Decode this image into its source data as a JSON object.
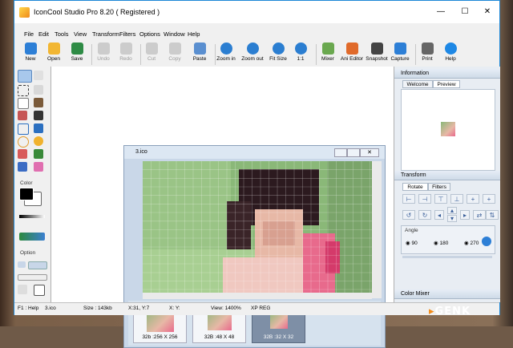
{
  "window": {
    "title": "IconCool Studio Pro 8.20 ( Registered )",
    "controls": [
      "—",
      "☐",
      "✕"
    ]
  },
  "menu": [
    "File",
    "Edit",
    "Tools",
    "View",
    "Transform",
    "Filters",
    "Options",
    "Window",
    "Help"
  ],
  "toolbar": [
    {
      "label": "New",
      "icon": "new-icon",
      "color": "#2d7fd6",
      "disabled": false
    },
    {
      "label": "Open",
      "icon": "open-icon",
      "color": "#f2b632",
      "disabled": false
    },
    {
      "label": "Save",
      "icon": "save-icon",
      "color": "#2e8b45",
      "disabled": false
    },
    {
      "label": "Undo",
      "icon": "undo-icon",
      "color": "#8a8a8a",
      "disabled": true
    },
    {
      "label": "Redo",
      "icon": "redo-icon",
      "color": "#8a8a8a",
      "disabled": true
    },
    {
      "label": "Cut",
      "icon": "cut-icon",
      "color": "#8a8a8a",
      "disabled": true
    },
    {
      "label": "Copy",
      "icon": "copy-icon",
      "color": "#8a8a8a",
      "disabled": true
    },
    {
      "label": "Paste",
      "icon": "paste-icon",
      "color": "#5a8fd0",
      "disabled": false
    },
    {
      "label": "Zoom in",
      "icon": "zoom-in-icon",
      "color": "#2b7ed1",
      "disabled": false
    },
    {
      "label": "Zoom out",
      "icon": "zoom-out-icon",
      "color": "#2b7ed1",
      "disabled": false
    },
    {
      "label": "Fit Size",
      "icon": "fit-size-icon",
      "color": "#2b7ed1",
      "disabled": false
    },
    {
      "label": "1:1",
      "icon": "actual-size-icon",
      "color": "#2b7ed1",
      "disabled": false
    },
    {
      "label": "Mixer",
      "icon": "mixer-icon",
      "color": "#6aa84f",
      "disabled": false
    },
    {
      "label": "Ani Editor",
      "icon": "ani-editor-icon",
      "color": "#e06a2a",
      "disabled": false
    },
    {
      "label": "Snapshot",
      "icon": "snapshot-icon",
      "color": "#444444",
      "disabled": false
    },
    {
      "label": "Capture",
      "icon": "capture-icon",
      "color": "#2d7fd6",
      "disabled": false
    },
    {
      "label": "Print",
      "icon": "print-icon",
      "color": "#666666",
      "disabled": false
    },
    {
      "label": "Help",
      "icon": "help-icon",
      "color": "#1e88e5",
      "disabled": false
    }
  ],
  "left_panel": {
    "color_label": "Color",
    "option_label": "Option"
  },
  "document": {
    "title": "3.ico",
    "thumbnails": [
      {
        "caption": "32b :256 X 256",
        "selected": false
      },
      {
        "caption": "32B :48 X 48",
        "selected": false
      },
      {
        "caption": "32B :32 X 32",
        "selected": true
      }
    ]
  },
  "right_panel": {
    "information": {
      "title": "Information",
      "tabs": [
        "Welcome",
        "Preview"
      ],
      "active_tab": "Preview"
    },
    "transform": {
      "title": "Transform",
      "tabs": [
        "Rotate",
        "Filters"
      ],
      "active_tab": "Rotate",
      "angle_label": "Angle",
      "angles": [
        "90",
        "180",
        "270"
      ]
    },
    "color_mixer": {
      "title": "Color Mixer"
    }
  },
  "status": {
    "help": "F1 : Help",
    "file": "3.ico",
    "size": "Size : 143kb",
    "position": "X:31, Y:7",
    "xy": "X: Y:",
    "view": "View: 1400%",
    "mode": "XP REG"
  },
  "watermark": {
    "text": "GENK"
  },
  "colors": {
    "foreground": "#000000",
    "background": "#ffffff",
    "accent": "#1c86d6"
  }
}
